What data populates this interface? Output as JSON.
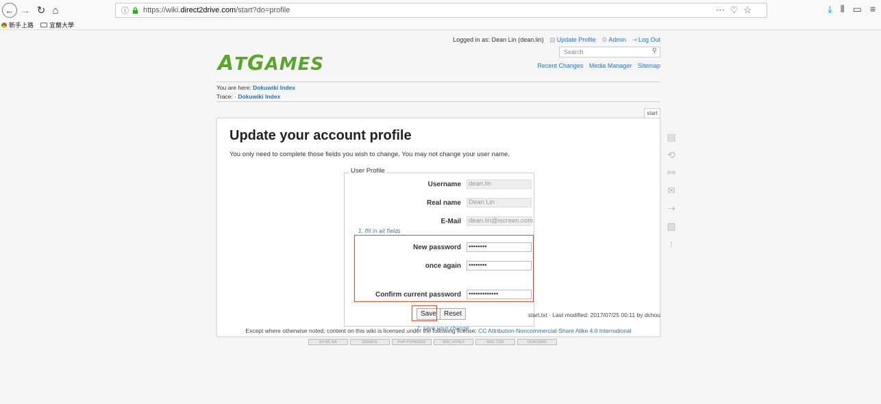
{
  "browser": {
    "url_prefix": "https://wiki.",
    "url_domain": "direct2drive.com",
    "url_suffix": "/start?do=profile",
    "bookmarks": [
      "新手上路",
      "宜蘭大學"
    ]
  },
  "header": {
    "logged_in": "Logged in as: Dean Lin (dean.lin)",
    "update_profile": "Update Profile",
    "admin": "Admin",
    "logout": "Log Out",
    "logo_a": "A",
    "logo_rest": "T",
    "logo_mid": "G",
    "logo_end": "AMES",
    "search_placeholder": "Search",
    "recent_changes": "Recent Changes",
    "media_manager": "Media Manager",
    "sitemap": "Sitemap"
  },
  "breadcrumbs": {
    "you_are_here": "You are here: ",
    "you_are_here_link": "Dokuwiki Index",
    "trace": "Trace: · ",
    "trace_link": "Dokuwiki Index"
  },
  "tab_start": "start",
  "content": {
    "title": "Update your account profile",
    "intro": "You only need to complete those fields you wish to change. You may not change your user name.",
    "legend": "User Profile",
    "fields": {
      "username_label": "Username",
      "username_value": "dean.lin",
      "realname_label": "Real name",
      "realname_value": "Dean Lin",
      "email_label": "E-Mail",
      "email_value": "dean.lin@iscreen.com",
      "newpass_label": "New password",
      "newpass_value": "••••••••",
      "again_label": "once again",
      "again_value": "••••••••",
      "confirm_label": "Confirm current password",
      "confirm_value": "•••••••••••••"
    },
    "hint1": "1. fill in all fields",
    "hint2": "2. save your change",
    "save": "Save",
    "reset": "Reset"
  },
  "footer": {
    "lastmod": "start.txt · Last modified: 2017/07/25 00:11 by dchou",
    "license_text": "Except where otherwise noted, content on this wiki is licensed under the following license: ",
    "license_link": "CC Attribution-Noncommercial-Share Alike 4.0 International",
    "badges": [
      "BY-NC-SA",
      "DONATE",
      "PHP POWERED",
      "W3C HTML5",
      "W3C CSS",
      "DOKUWIKI"
    ]
  }
}
